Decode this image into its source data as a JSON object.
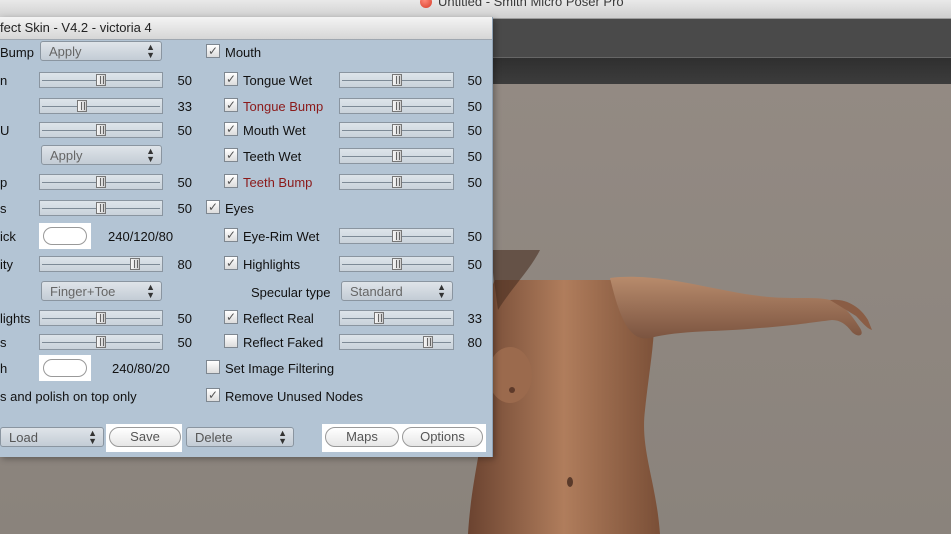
{
  "app": {
    "title": "Untitled - Smith Micro Poser Pro"
  },
  "panel": {
    "title": "fect Skin - V4.2 - victoria 4",
    "left": {
      "rows": [
        {
          "label": "Bump",
          "dropdown": "Apply"
        },
        {
          "label": "n",
          "value": "50",
          "slider": 0.5
        },
        {
          "label": "",
          "value": "33",
          "slider": 0.33
        },
        {
          "label": "U",
          "value": "50",
          "slider": 0.5
        },
        {
          "dropdown": "Apply"
        },
        {
          "label": "p",
          "value": "50",
          "slider": 0.5
        },
        {
          "label": "s",
          "value": "50",
          "slider": 0.5
        },
        {
          "label": "ick",
          "color_value": "240/120/80"
        },
        {
          "label": "ity",
          "value": "80",
          "slider": 0.8
        },
        {
          "dropdown": "Finger+Toe"
        },
        {
          "label": "lights",
          "value": "50",
          "slider": 0.5
        },
        {
          "label": "s",
          "value": "50",
          "slider": 0.5
        },
        {
          "label": "h",
          "color_value": "240/80/20"
        },
        {
          "label": "s and polish on top only"
        }
      ]
    },
    "right": {
      "mouth": {
        "label": "Mouth",
        "checked": true
      },
      "tongue_wet": {
        "label": "Tongue Wet",
        "checked": true,
        "value": "50",
        "slider": 0.5
      },
      "tongue_bump": {
        "label": "Tongue Bump",
        "checked": true,
        "value": "50",
        "slider": 0.5
      },
      "mouth_wet": {
        "label": "Mouth Wet",
        "checked": true,
        "value": "50",
        "slider": 0.5
      },
      "teeth_wet": {
        "label": "Teeth Wet",
        "checked": true,
        "value": "50",
        "slider": 0.5
      },
      "teeth_bump": {
        "label": "Teeth Bump",
        "checked": true,
        "value": "50",
        "slider": 0.5
      },
      "eyes": {
        "label": "Eyes",
        "checked": true
      },
      "eye_rim_wet": {
        "label": "Eye-Rim Wet",
        "checked": true,
        "value": "50",
        "slider": 0.5
      },
      "highlights": {
        "label": "Highlights",
        "checked": true,
        "value": "50",
        "slider": 0.5
      },
      "specular_type": {
        "label": "Specular type",
        "value": "Standard"
      },
      "reflect_real": {
        "label": "Reflect Real",
        "checked": true,
        "value": "33",
        "slider": 0.33
      },
      "reflect_faked": {
        "label": "Reflect Faked",
        "checked": false,
        "value": "80",
        "slider": 0.8
      },
      "set_image_filtering": {
        "label": "Set Image Filtering",
        "checked": false
      },
      "remove_unused_nodes": {
        "label": "Remove Unused Nodes",
        "checked": true
      }
    },
    "bottom": {
      "load": "Load",
      "save": "Save",
      "delete": "Delete",
      "maps": "Maps",
      "options": "Options"
    }
  },
  "colors": {
    "panel_bg": "#b3c4d4",
    "accent_red": "#8b1a1a",
    "viewport_bg": "#8e8880"
  }
}
